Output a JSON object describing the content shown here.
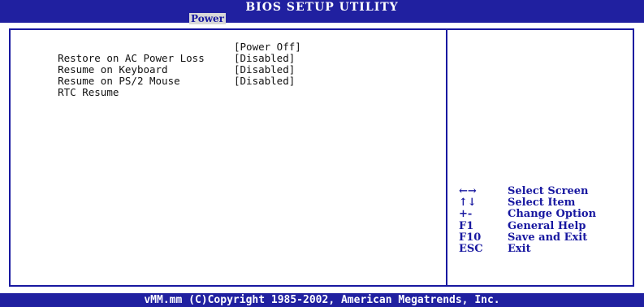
{
  "header": {
    "title": "BIOS SETUP UTILITY",
    "active_tab": "Power"
  },
  "settings": [
    {
      "label": "Restore on AC Power Loss",
      "value": "[Power Off]"
    },
    {
      "label": "Resume on Keyboard",
      "value": "[Disabled]"
    },
    {
      "label": "Resume on PS/2 Mouse",
      "value": "[Disabled]"
    },
    {
      "label": "RTC Resume",
      "value": "[Disabled]"
    }
  ],
  "legend": [
    {
      "key": "←→",
      "desc": "Select Screen"
    },
    {
      "key": "↑↓",
      "desc": "Select Item"
    },
    {
      "key": "+-",
      "desc": "Change Option"
    },
    {
      "key": "F1",
      "desc": "General Help"
    },
    {
      "key": "F10",
      "desc": "Save and Exit"
    },
    {
      "key": "ESC",
      "desc": "Exit"
    }
  ],
  "footer": {
    "copyright": "vMM.mm (C)Copyright 1985-2002, American Megatrends, Inc."
  },
  "colors": {
    "bar_blue": "#2020a0",
    "text_blue": "#1818a0",
    "tab_bg": "#d8d8d8",
    "background": "#ffffff"
  }
}
